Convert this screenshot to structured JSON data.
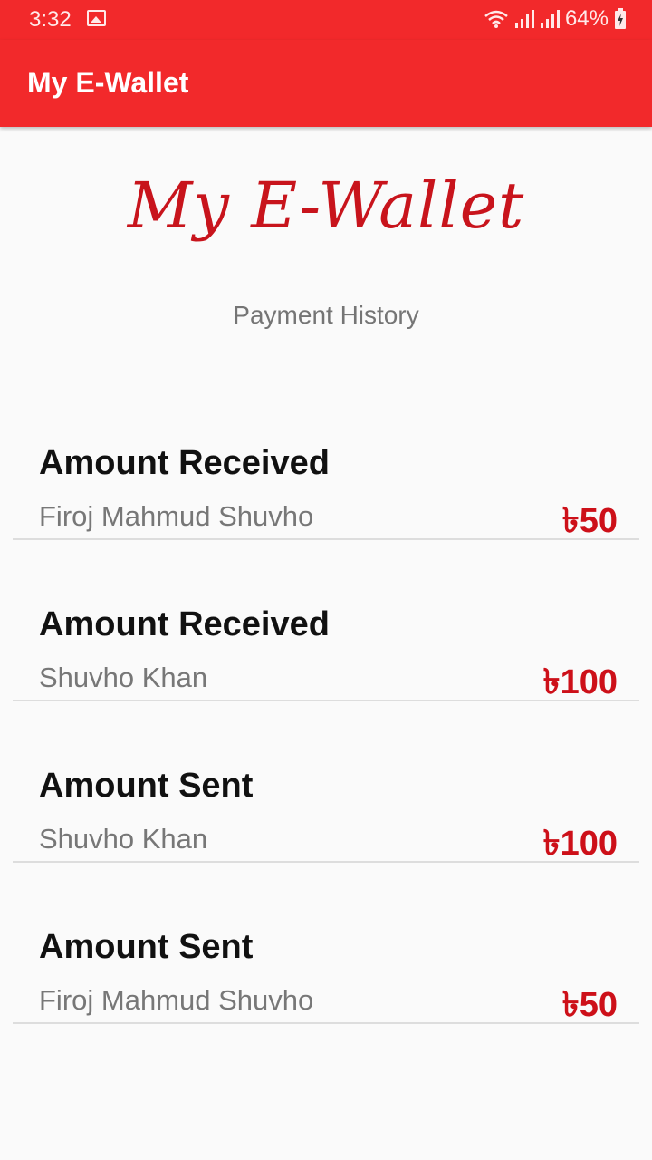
{
  "status_bar": {
    "time": "3:32",
    "battery_percent": "64%",
    "icons": [
      "image-icon",
      "wifi-icon",
      "signal-icon",
      "signal-icon",
      "battery-charging-icon"
    ]
  },
  "app_bar": {
    "title": "My E-Wallet"
  },
  "header": {
    "brand": "My E-Wallet",
    "subtitle": "Payment History"
  },
  "transactions": [
    {
      "type": "Amount Received",
      "name": "Firoj Mahmud Shuvho",
      "amount": "৳50"
    },
    {
      "type": "Amount Received",
      "name": "Shuvho Khan",
      "amount": "৳100"
    },
    {
      "type": "Amount Sent",
      "name": "Shuvho Khan",
      "amount": "৳100"
    },
    {
      "type": "Amount Sent",
      "name": "Firoj Mahmud Shuvho",
      "amount": "৳50"
    }
  ],
  "colors": {
    "primary": "#f2292b",
    "brand_text": "#c8141c",
    "amount": "#cd1019",
    "background": "#fafafa"
  }
}
